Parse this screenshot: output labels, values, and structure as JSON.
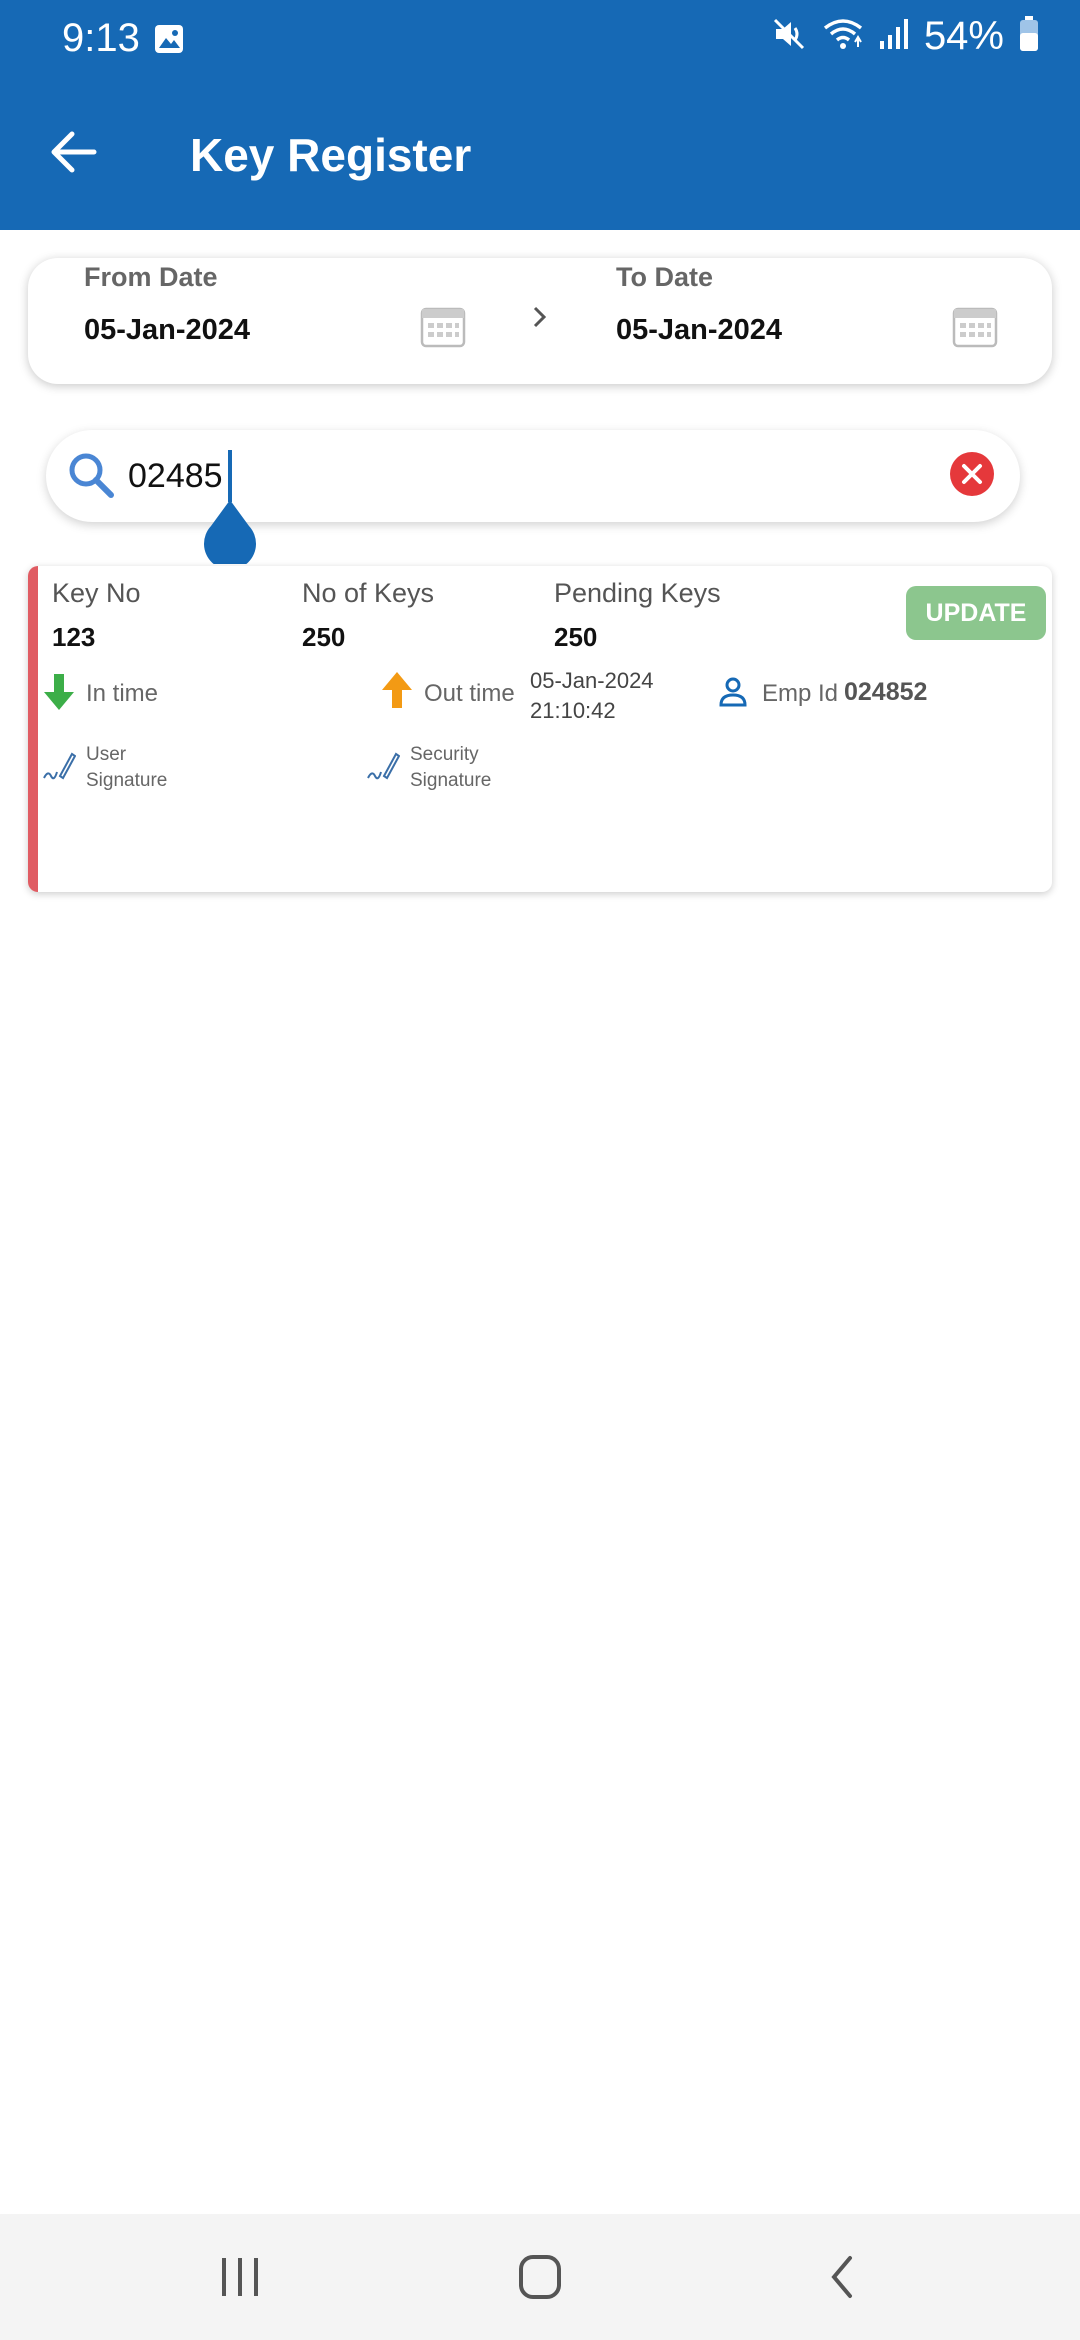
{
  "status_bar": {
    "time": "9:13",
    "battery": "54%",
    "icons": [
      "gallery-icon",
      "mute-icon",
      "wifi-icon",
      "signal-icon",
      "battery-icon"
    ]
  },
  "app_bar": {
    "title": "Key Register",
    "back_icon": "arrow-left-icon"
  },
  "date_range": {
    "from_label": "From Date",
    "from_value": "05-Jan-2024",
    "to_label": "To Date",
    "to_value": "05-Jan-2024"
  },
  "search": {
    "value": "02485",
    "placeholder": ""
  },
  "records": [
    {
      "key_no_label": "Key No",
      "key_no": "123",
      "no_of_keys_label": "No of Keys",
      "no_of_keys": "250",
      "pending_keys_label": "Pending Keys",
      "pending_keys": "250",
      "update_label": "UPDATE",
      "in_time_label": "In time",
      "out_time_label": "Out time",
      "out_date": "05-Jan-2024",
      "out_time": "21:10:42",
      "emp_id_label": "Emp Id",
      "emp_id": "024852",
      "user_signature_line1": "User",
      "user_signature_line2": "Signature",
      "security_signature_line1": "Security",
      "security_signature_line2": "Signature"
    }
  ],
  "colors": {
    "primary": "#1669b5",
    "card_stripe": "#e05c63",
    "update_button": "#8cc68e",
    "in_arrow": "#3cae48",
    "out_arrow": "#f39a14",
    "clear_button": "#e5383b"
  }
}
